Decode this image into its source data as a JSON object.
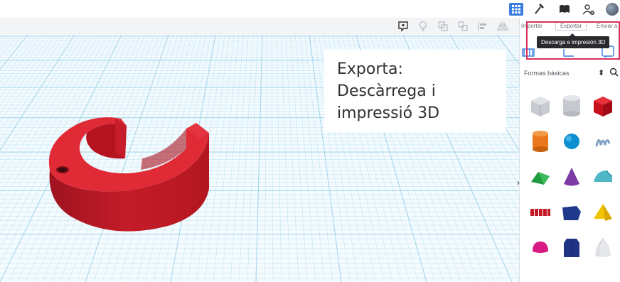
{
  "caption": {
    "line1": "Exporta:",
    "line2": "Descàrrega i",
    "line3": "impressió 3D"
  },
  "panel": {
    "tabs": [
      "Importar",
      "Exportar",
      "Enviar a"
    ],
    "tooltip": "Descarga e impresión 3D",
    "shapes_category": "Formas básicas",
    "select_arrow": "⬍"
  },
  "collapse_arrow": "›",
  "colors": {
    "accent": "#3c7de0",
    "highlight": "#d8315b",
    "model_red": "#d71f2b",
    "grid_line": "#9fd2ea"
  },
  "shapes": [
    {
      "name": "box-striped"
    },
    {
      "name": "cylinder-striped"
    },
    {
      "name": "red-box"
    },
    {
      "name": "orange-cylinder"
    },
    {
      "name": "blue-sphere"
    },
    {
      "name": "scribble"
    },
    {
      "name": "green-roof"
    },
    {
      "name": "purple-cone"
    },
    {
      "name": "teal-round-roof"
    },
    {
      "name": "red-text"
    },
    {
      "name": "navy-box"
    },
    {
      "name": "yellow-pyramid"
    },
    {
      "name": "pink-half-sphere"
    },
    {
      "name": "navy-polygon"
    },
    {
      "name": "white-paraboloid"
    }
  ]
}
